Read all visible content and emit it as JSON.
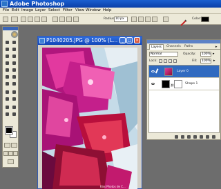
{
  "app": {
    "title": "Adobe Photoshop"
  },
  "menu": [
    "File",
    "Edit",
    "Image",
    "Layer",
    "Select",
    "Filter",
    "View",
    "Window",
    "Help"
  ],
  "options_bar": {
    "radius_label": "Radius:",
    "radius_value": "10 px",
    "color_label": "Color:",
    "brush_icon": "red-brush-icon"
  },
  "colors": {
    "titlebar": "#0a3fa8",
    "selected_layer": "#306ac0",
    "foreground": "#000000",
    "background": "#ffffff"
  },
  "document": {
    "title": "P1040205.JPG @ 100% (L...",
    "photo_caption": "Kiss Photos de C..."
  },
  "layers_palette": {
    "tabs": [
      "Layers",
      "Channels",
      "Paths"
    ],
    "blend_mode": "Normal",
    "opacity_label": "Opacity:",
    "opacity_value": "100%",
    "lock_label": "Lock:",
    "fill_label": "Fill:",
    "fill_value": "100%",
    "layers": [
      {
        "name": "Layer 0",
        "selected": true
      },
      {
        "name": "Shape 1",
        "selected": false
      }
    ]
  }
}
